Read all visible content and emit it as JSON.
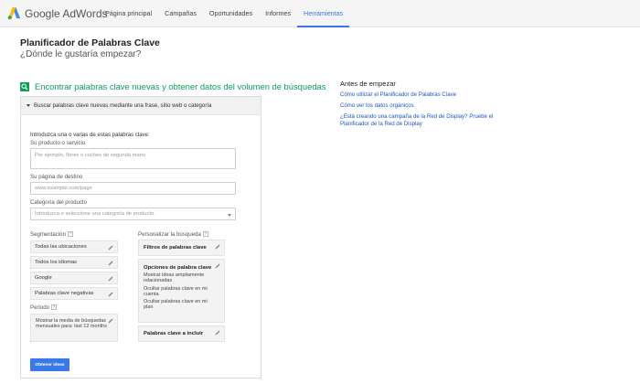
{
  "brand": {
    "name": "Google AdWords",
    "accent": "#3b78e7",
    "green": "#0f9d58"
  },
  "nav": {
    "items": [
      {
        "label": "Página principal",
        "active": false
      },
      {
        "label": "Campañas",
        "active": false
      },
      {
        "label": "Oportunidades",
        "active": false
      },
      {
        "label": "Informes",
        "active": false
      },
      {
        "label": "Herramientas",
        "active": true
      }
    ]
  },
  "page": {
    "title": "Planificador de Palabras Clave",
    "subtitle": "¿Dónde le gustaría empezar?"
  },
  "section": {
    "icon": "search-icon",
    "title": "Encontrar palabras clave nuevas y obtener datos del volumen de búsquedas",
    "panel_header": "Buscar palabras clave nuevas mediante una frase, sitio web o categoría"
  },
  "form": {
    "intro": "Introduzca una o varias de estas palabras clave:",
    "product_label": "Su producto o servicio",
    "product_placeholder": "Por ejemplo, flores o coches de segunda mano",
    "landing_label": "Su página de destino",
    "landing_placeholder": "www.example.com/page",
    "category_label": "Categoría del producto",
    "category_placeholder": "Introduzca o seleccione una categoría de producto.",
    "targeting_label": "Segmentación",
    "targeting_items": [
      "Todas las ubicaciones",
      "Todos los idiomas",
      "Google",
      "Palabras clave negativas"
    ],
    "period_label": "Periodo",
    "period_text": "Mostrar la media de búsquedas mensuales para: last 12 months",
    "customize_label": "Personalizar la búsqueda",
    "filters_title": "Filtros de palabras clave",
    "options_title": "Opciones de palabra clave",
    "options_lines": [
      "Mostrar ideas ampliamente relacionadas",
      "Ocultar palabras clave en mi cuenta",
      "Ocultar palabras clave en mi plan"
    ],
    "include_title": "Palabras clave a incluir",
    "submit_label": "Obtener ideas"
  },
  "aside": {
    "title": "Antes de empezar",
    "links": [
      "Cómo utilizar el Planificador de Palabras Clave",
      "Cómo ver los datos orgánicos",
      "¿Está creando una campaña de la Red de Display? Pruebe el Planificador de la Red de Display"
    ]
  }
}
